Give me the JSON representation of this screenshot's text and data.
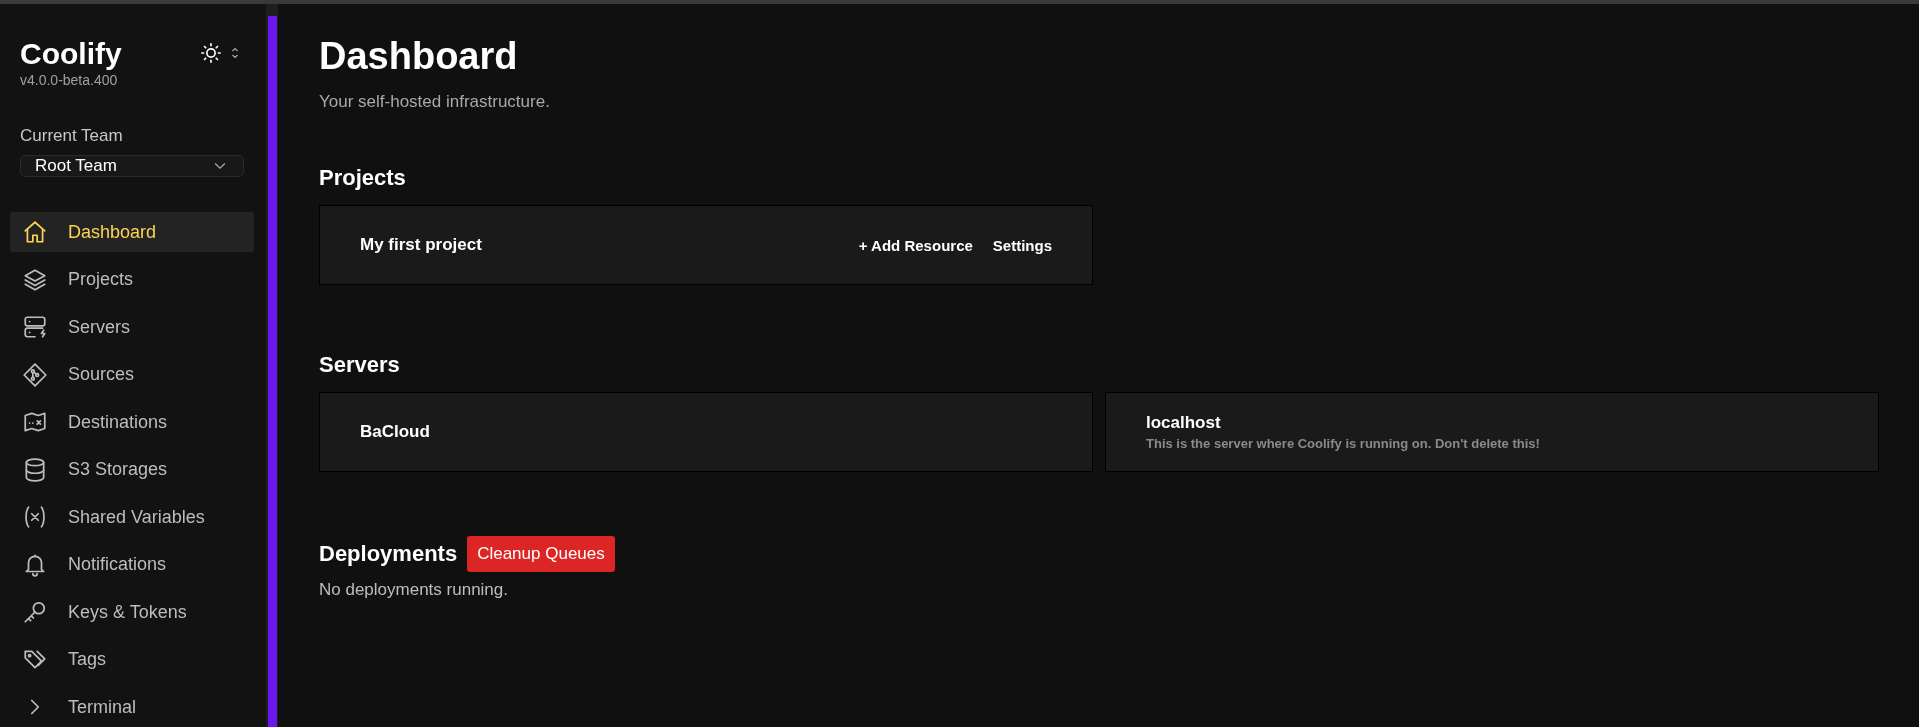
{
  "sidebar": {
    "app_name": "Coolify",
    "version": "v4.0.0-beta.400",
    "team_label": "Current Team",
    "team_select": {
      "value": "Root Team"
    },
    "items": [
      {
        "label": "Dashboard",
        "kind": "home",
        "selected": true
      },
      {
        "label": "Projects",
        "kind": "layers",
        "selected": false
      },
      {
        "label": "Servers",
        "kind": "server",
        "selected": false
      },
      {
        "label": "Sources",
        "kind": "git",
        "selected": false
      },
      {
        "label": "Destinations",
        "kind": "map",
        "selected": false
      },
      {
        "label": "S3 Storages",
        "kind": "database",
        "selected": false
      },
      {
        "label": "Shared Variables",
        "kind": "variable",
        "selected": false
      },
      {
        "label": "Notifications",
        "kind": "bell",
        "selected": false
      },
      {
        "label": "Keys & Tokens",
        "kind": "key",
        "selected": false
      },
      {
        "label": "Tags",
        "kind": "tag",
        "selected": false
      },
      {
        "label": "Terminal",
        "kind": "chevron",
        "selected": false
      }
    ]
  },
  "main": {
    "title": "Dashboard",
    "subtitle": "Your self-hosted infrastructure.",
    "projects": {
      "heading": "Projects",
      "items": [
        {
          "name": "My first project",
          "actions": [
            "+ Add Resource",
            "Settings"
          ]
        }
      ]
    },
    "servers": {
      "heading": "Servers",
      "items": [
        {
          "name": "BaCloud"
        },
        {
          "name": "localhost",
          "description": "This is the server where Coolify is running on. Don't delete this!"
        }
      ]
    },
    "deployments": {
      "heading": "Deployments",
      "button": "Cleanup Queues",
      "empty_text": "No deployments running."
    }
  }
}
